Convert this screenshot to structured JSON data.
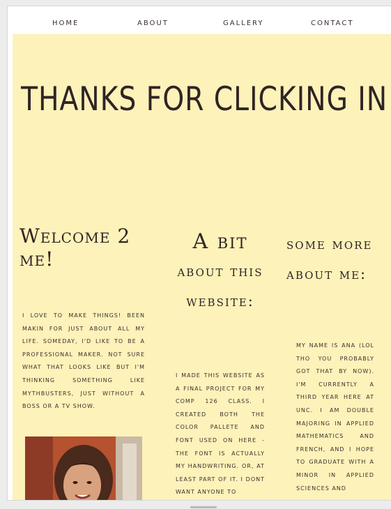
{
  "nav": {
    "home": "HOME",
    "about": "ABOUT",
    "gallery": "GALLERY",
    "contact": "CONTACT"
  },
  "hero": {
    "title": "THANKS FOR CLICKING IN!"
  },
  "columns": [
    {
      "heading": "Welcome 2 me!",
      "text": "I LOVE TO MAKE THINGS! BEEN MAKIN FOR JUST ABOUT ALL MY LIFE. SOMEDAY, I'D LIKE TO BE A PROFESSIONAL MAKER. NOT SURE WHAT THAT LOOKS LIKE BUT I'M THINKING SOMETHING LIKE MYTHBUSTERS, JUST WITHOUT A BOSS OR A TV SHOW."
    },
    {
      "heading_line1": "A bit",
      "heading_line2": "about this",
      "heading_line3": "website:",
      "text": "I MADE THIS WEBSITE AS A FINAL PROJECT FOR MY COMP 126 CLASS. I CREATED BOTH THE COLOR PALLETE AND FONT USED ON HERE - THE FONT IS ACTUALLY MY HANDWRITING. OR, AT LEAST PART OF IT. I DONT WANT ANYONE TO"
    },
    {
      "heading_line1": "some more",
      "heading_line2": "about me:",
      "text": "MY NAME IS ANA (LOL THO YOU PROBABLY GOT THAT BY NOW). I'M CURRENTLY A THIRD YEAR HERE AT UNC. I AM DOUBLE MAJORING IN APPLIED MATHEMATICS AND FRENCH, AND I HOPE TO GRADUATE WITH A MINOR IN APPLIED SCIENCES AND"
    }
  ],
  "colors": {
    "page_background": "#fdf2b9",
    "text": "#2f2424",
    "nav_background": "#ffffff"
  }
}
